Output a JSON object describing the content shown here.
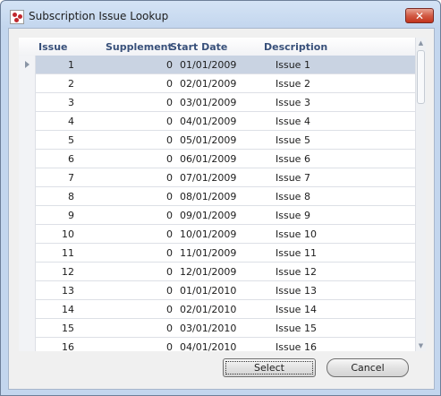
{
  "window": {
    "title": "Subscription Issue Lookup",
    "close_label": "✕"
  },
  "grid": {
    "columns": [
      "Issue",
      "Supplement",
      "Start Date",
      "Description"
    ],
    "rows": [
      {
        "issue": "1",
        "supplement": "0",
        "start_date": "01/01/2009",
        "description": "Issue 1"
      },
      {
        "issue": "2",
        "supplement": "0",
        "start_date": "02/01/2009",
        "description": "Issue 2"
      },
      {
        "issue": "3",
        "supplement": "0",
        "start_date": "03/01/2009",
        "description": "Issue 3"
      },
      {
        "issue": "4",
        "supplement": "0",
        "start_date": "04/01/2009",
        "description": "Issue 4"
      },
      {
        "issue": "5",
        "supplement": "0",
        "start_date": "05/01/2009",
        "description": "Issue 5"
      },
      {
        "issue": "6",
        "supplement": "0",
        "start_date": "06/01/2009",
        "description": "Issue 6"
      },
      {
        "issue": "7",
        "supplement": "0",
        "start_date": "07/01/2009",
        "description": "Issue 7"
      },
      {
        "issue": "8",
        "supplement": "0",
        "start_date": "08/01/2009",
        "description": "Issue 8"
      },
      {
        "issue": "9",
        "supplement": "0",
        "start_date": "09/01/2009",
        "description": "Issue 9"
      },
      {
        "issue": "10",
        "supplement": "0",
        "start_date": "10/01/2009",
        "description": "Issue 10"
      },
      {
        "issue": "11",
        "supplement": "0",
        "start_date": "11/01/2009",
        "description": "Issue 11"
      },
      {
        "issue": "12",
        "supplement": "0",
        "start_date": "12/01/2009",
        "description": "Issue 12"
      },
      {
        "issue": "13",
        "supplement": "0",
        "start_date": "01/01/2010",
        "description": "Issue 13"
      },
      {
        "issue": "14",
        "supplement": "0",
        "start_date": "02/01/2010",
        "description": "Issue 14"
      },
      {
        "issue": "15",
        "supplement": "0",
        "start_date": "03/01/2010",
        "description": "Issue 15"
      },
      {
        "issue": "16",
        "supplement": "0",
        "start_date": "04/01/2010",
        "description": "Issue 16"
      }
    ],
    "selected_index": 0
  },
  "buttons": {
    "select": "Select",
    "cancel": "Cancel"
  },
  "colors": {
    "selected_row": "#c9d3e2",
    "header_text": "#38507a",
    "close_button": "#c3341c"
  },
  "icons": {
    "app": "app-logo-icon",
    "row_indicator": "row-pointer-icon"
  }
}
